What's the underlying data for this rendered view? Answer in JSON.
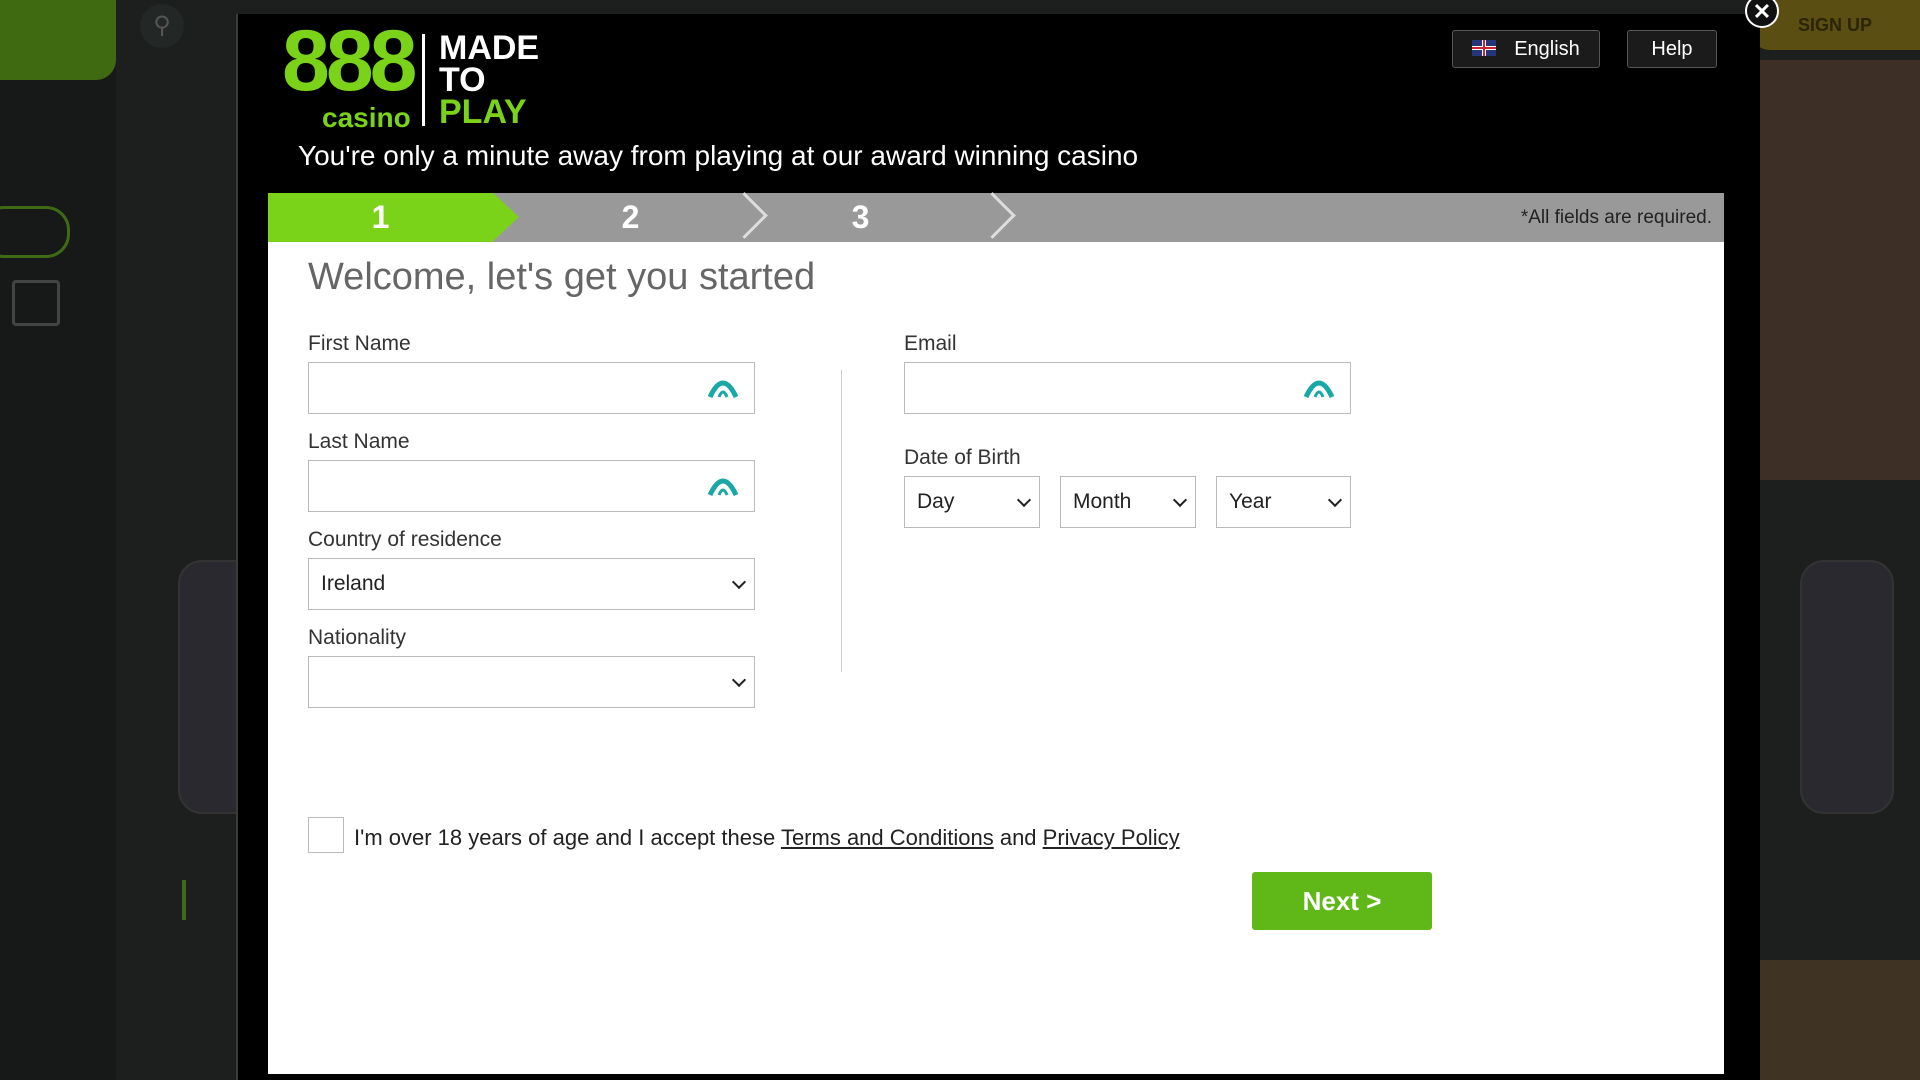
{
  "background": {
    "signup_label": "SIGN UP"
  },
  "modal": {
    "logo": {
      "number": "888",
      "sub": "casino",
      "made": "MADE",
      "to": "TO",
      "play": "PLAY"
    },
    "tagline": "You're only a minute away from playing at our award winning casino",
    "language_label": "English",
    "help_label": "Help",
    "close_label": "✕",
    "steps": [
      "1",
      "2",
      "3"
    ],
    "required_note": "*All fields are required.",
    "form": {
      "heading": "Welcome, let's get you started",
      "first_name_label": "First Name",
      "last_name_label": "Last Name",
      "country_label": "Country of residence",
      "country_value": "Ireland",
      "nationality_label": "Nationality",
      "nationality_value": "",
      "email_label": "Email",
      "dob_label": "Date of Birth",
      "dob_day": "Day",
      "dob_month": "Month",
      "dob_year": "Year",
      "terms_prefix": "I'm over 18 years of age and I accept these ",
      "terms_link": "Terms and Conditions",
      "terms_and": " and ",
      "privacy_link": "Privacy Policy",
      "next_label": "Next >"
    }
  },
  "colors": {
    "brand_green": "#7bd319",
    "button_green": "#5fb818",
    "field_icon": "#1aa7a7"
  }
}
